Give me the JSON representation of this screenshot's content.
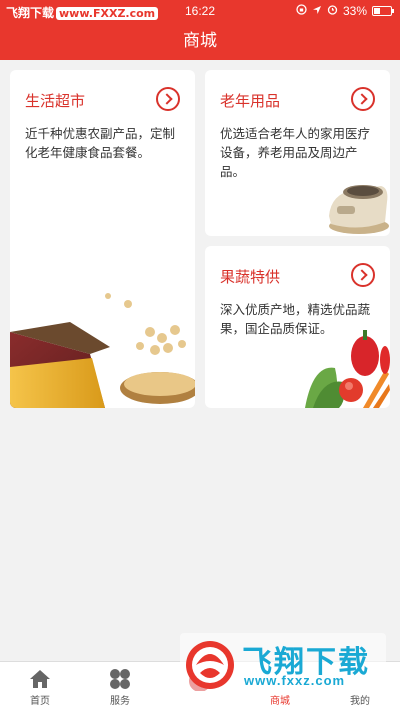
{
  "status": {
    "watermark_left": "飞翔下载",
    "watermark_url": "www.FXXZ.com",
    "time": "16:22",
    "battery": "33%"
  },
  "nav": {
    "title": "商城"
  },
  "cards": [
    {
      "title": "生活超市",
      "desc": "近千种优惠农副产品，定制化老年健康食品套餐。"
    },
    {
      "title": "老年用品",
      "desc": "优选适合老年人的家用医疗设备，养老用品及周边产品。"
    },
    {
      "title": "果蔬特供",
      "desc": "深入优质产地，精选优品蔬果，国企品质保证。"
    }
  ],
  "tabs": [
    {
      "label": "首页"
    },
    {
      "label": "服务"
    },
    {
      "label": ""
    },
    {
      "label": "商城"
    },
    {
      "label": "我的"
    }
  ],
  "watermark": {
    "text": "飞翔下载",
    "url": "www.fxxz.com"
  },
  "colors": {
    "brand": "#e8372d"
  }
}
